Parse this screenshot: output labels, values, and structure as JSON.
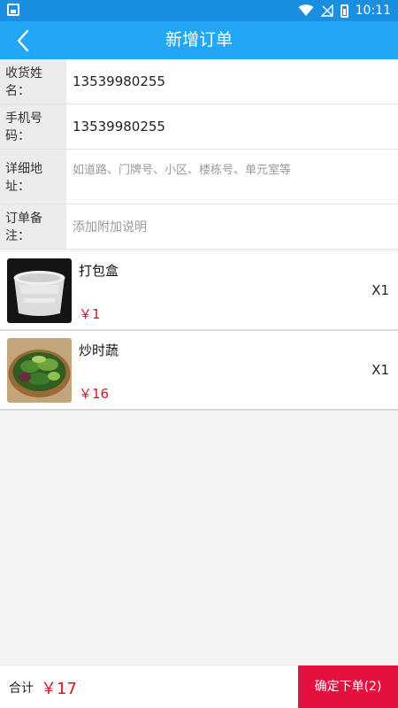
{
  "status_bar": {
    "time": "10:11"
  },
  "header": {
    "title": "新增订单",
    "back_icon": "chevron-left-icon"
  },
  "form": {
    "name": {
      "label": "收货姓名：",
      "value": "13539980255"
    },
    "phone": {
      "label": "手机号码：",
      "value": "13539980255"
    },
    "address": {
      "label": "详细地址：",
      "placeholder": "如道路、门牌号、小区、楼栋号、单元室等"
    },
    "note": {
      "label": "订单备注：",
      "placeholder": "添加附加说明"
    }
  },
  "items": [
    {
      "name": "打包盒",
      "price": "￥1",
      "qty": "X1"
    },
    {
      "name": "炒时蔬",
      "price": "￥16",
      "qty": "X1"
    }
  ],
  "footer": {
    "total_label": "合计",
    "total_value": "￥17",
    "confirm_label": "确定下单(2)"
  },
  "colors": {
    "nav": "#22a6f5",
    "status_bar": "#1a8fe0",
    "price": "#e0101e",
    "confirm": "#e4103e"
  }
}
